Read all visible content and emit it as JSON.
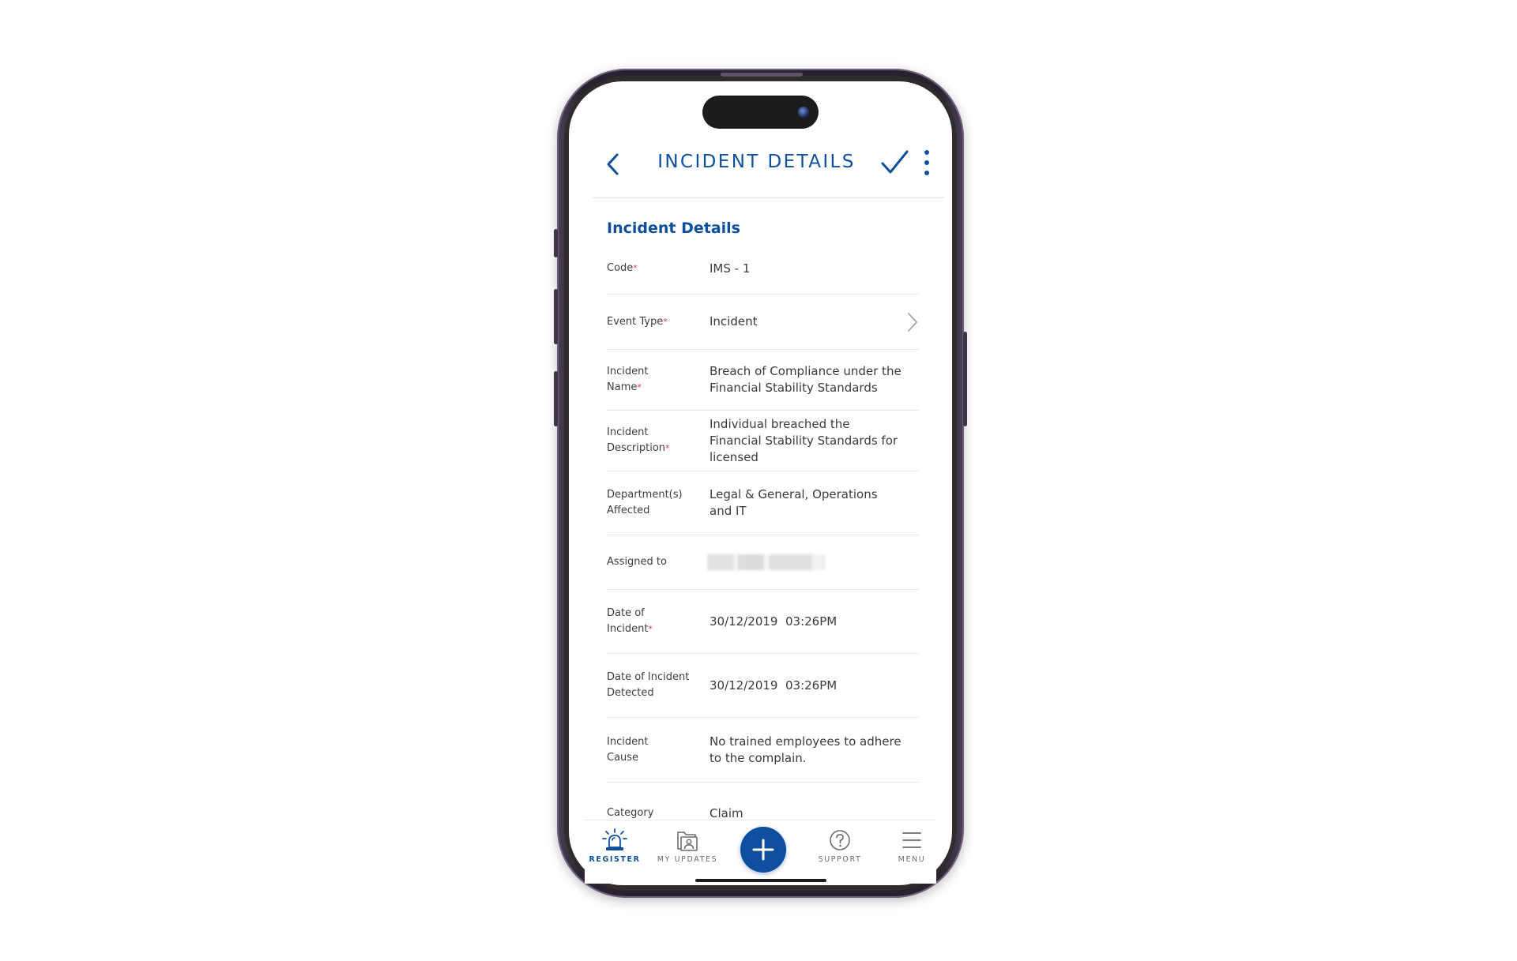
{
  "header": {
    "title": "INCIDENT DETAILS"
  },
  "section": {
    "title": "Incident Details"
  },
  "fields": {
    "code": {
      "label": "Code",
      "value": "IMS - 1"
    },
    "event_type": {
      "label": "Event Type",
      "value": "Incident"
    },
    "incident_name": {
      "label_line1": "Incident",
      "label_line2": "Name",
      "value": "Breach of Compliance under the Financial Stability Standards"
    },
    "incident_description": {
      "label_line1": "Incident",
      "label_line2": "Description",
      "value": "Individual breached the Financial Stability Standards for licensed"
    },
    "departments_affected": {
      "label_line1": "Department(s)",
      "label_line2": "Affected",
      "value": "Legal & General, Operations and IT"
    },
    "assigned_to": {
      "label": "Assigned to"
    },
    "date_of_incident": {
      "label_line1": "Date of",
      "label_line2": "Incident",
      "value": "30/12/2019  03:26PM"
    },
    "date_detected": {
      "label_line1": "Date of Incident",
      "label_line2": "Detected",
      "value": "30/12/2019  03:26PM"
    },
    "incident_cause": {
      "label_line1": "Incident",
      "label_line2": "Cause",
      "value": "No trained employees to adhere to the complain."
    },
    "category": {
      "label": "Category",
      "value": "Claim"
    }
  },
  "required_marker": "*",
  "nav": {
    "register": "REGISTER",
    "my_updates": "MY UPDATES",
    "support": "SUPPORT",
    "menu": "MENU"
  },
  "colors": {
    "accent": "#0d4f9e",
    "required": "#d9363e",
    "text": "#3a3a3a",
    "divider": "#e6e6e6"
  },
  "icons": {
    "back": "chevron-left-icon",
    "save": "checkmark-icon",
    "more": "more-vertical-icon",
    "row_action": "chevron-right-icon",
    "register": "alarm-bell-icon",
    "my_updates": "folder-user-icon",
    "add": "plus-icon",
    "support": "question-circle-icon",
    "menu": "hamburger-icon"
  }
}
